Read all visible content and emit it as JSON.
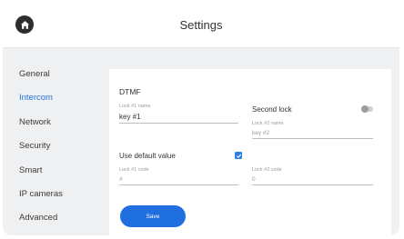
{
  "header": {
    "title": "Settings",
    "home_icon": "home-icon"
  },
  "sidebar": {
    "items": [
      {
        "label": "General"
      },
      {
        "label": "Intercom"
      },
      {
        "label": "Network"
      },
      {
        "label": "Security"
      },
      {
        "label": "Smart"
      },
      {
        "label": "IP cameras"
      },
      {
        "label": "Advanced"
      }
    ],
    "active_label": "Intercom"
  },
  "dtmf": {
    "title": "DTMF",
    "lock1_name": {
      "label": "Lock #1 name",
      "value": "key #1"
    },
    "second_lock": {
      "label": "Second lock",
      "enabled": false
    },
    "lock2_name": {
      "label": "Lock #2 name",
      "placeholder": "key #2"
    },
    "use_default": {
      "label": "Use default value",
      "checked": true
    },
    "lock1_code": {
      "label": "Lock #1 code",
      "placeholder": "#"
    },
    "lock2_code": {
      "label": "Lock #2 code",
      "placeholder": "0"
    },
    "save_label": "Save"
  },
  "colors": {
    "accent": "#1f6fde",
    "active_nav": "#1f75d8",
    "background": "#eff0f2"
  }
}
